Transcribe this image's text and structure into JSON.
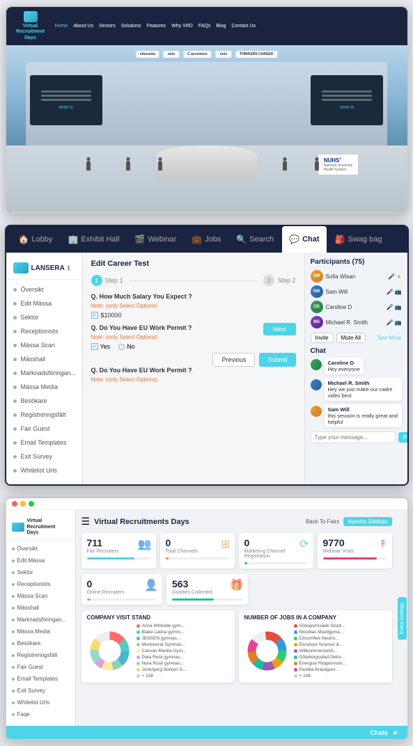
{
  "topWebsite": {
    "logoText": "Virtual\nRecruitment\nDays",
    "navLinks": [
      "Home",
      "About Us",
      "Sectors",
      "Solutions",
      "Features",
      "Why VRD",
      "FAQs",
      "Blog",
      "Contact Us"
    ],
    "sponsors": [
      "educenta",
      "nets",
      "accenture",
      "nets",
      "accenture",
      "CAREER"
    ],
    "nuhs": {
      "name": "NUHS",
      "subtitle": "National University\nHealth System"
    }
  },
  "middleApp": {
    "nav": {
      "items": [
        {
          "label": "Lobby",
          "icon": "🏠"
        },
        {
          "label": "Exhibit Hall",
          "icon": "🏢"
        },
        {
          "label": "Webinar",
          "icon": "🎬"
        },
        {
          "label": "Jobs",
          "icon": "💼"
        },
        {
          "label": "Search",
          "icon": "🔍"
        },
        {
          "label": "Chat",
          "icon": "💬"
        },
        {
          "label": "Swag bag",
          "icon": "🎒"
        }
      ],
      "activeTab": "Chat"
    },
    "sidebar": {
      "brand": "LANSERA",
      "items": [
        "Översikt",
        "Edit Mässa",
        "Sektor",
        "Receptionists",
        "Mässa Scan",
        "Mässhall",
        "Marknadsföringan...",
        "Mässa Media",
        "Besökare",
        "Registreringsfält",
        "Fair Guest",
        "Email Templates",
        "Exit Survey",
        "Whitelist Urls"
      ]
    },
    "mainContent": {
      "title": "Edit Career Test",
      "step1Label": "Step 1",
      "step2Label": "Step 2",
      "q1": "Q. How Much Salary You Expect ?",
      "q1Note": "Note: (only Select Options)",
      "q1Value": "$10000",
      "q2": "Q. Do You Have EU Work Permit ?",
      "q2Note": "Note: (only Select Options)",
      "q2Yes": "Yes",
      "q2No": "No",
      "q3": "Q. Do You Have EU Work Permit ?",
      "q3Note": "Note: (only Select Options)",
      "btnNext": "Next",
      "btnPrevious": "Previous",
      "btnSubmit": "Submit"
    },
    "rightPanel": {
      "participantsTitle": "Participants (75)",
      "participants": [
        {
          "name": "Sofia Wisan",
          "initials": "SW",
          "color": "orange"
        },
        {
          "name": "Sam Will",
          "initials": "SW",
          "color": "blue"
        },
        {
          "name": "Caroline D",
          "initials": "CD",
          "color": "green"
        },
        {
          "name": "Michael R. Smith",
          "initials": "MS",
          "color": "purple"
        }
      ],
      "btnInvite": "Invite",
      "btnMuteAll": "Mute All",
      "linkSeeMore": "See More",
      "chatTitle": "Chat",
      "messages": [
        {
          "sender": "Caroline D",
          "text": "Hey everyone",
          "avatarColor": "green"
        },
        {
          "sender": "Michael R. Smith",
          "text": "Hey we just make our cadre video best",
          "avatarColor": "blue"
        },
        {
          "sender": "Sam Will",
          "text": "this session is really great and helpful",
          "avatarColor": "orange"
        }
      ],
      "chatPlaceholder": "Type your message...",
      "btnReply": "Reply"
    }
  },
  "bottomDashboard": {
    "title": "Virtual Recruitments Days",
    "titlebarBtn": "Back To Fairs",
    "user": "Ayesha Siddiqui",
    "sidebar": {
      "brand": "Virtual\nRecruitment\nDays",
      "items": [
        "Översikt",
        "Edit Mässa",
        "Sektor",
        "Receptionists",
        "Mässa Scan",
        "Mässhall",
        "Marknadsföringan...",
        "Mässa Media",
        "Besökare",
        "Registreringsfält",
        "Fair Guest",
        "Email Templates",
        "Exit Survey",
        "Whitelist Urls",
        "Faqe"
      ]
    },
    "stats": [
      {
        "num": "711",
        "label": "Fair Recruiters",
        "barColor": "#4dd4e8",
        "barWidth": "75%",
        "iconColor": "cyan"
      },
      {
        "num": "0",
        "label": "Total Channels",
        "barColor": "#f0803a",
        "barWidth": "5%",
        "iconColor": "orange"
      },
      {
        "num": "0",
        "label": "Marketing Channel Registration",
        "barColor": "#20c09a",
        "barWidth": "5%",
        "iconColor": "teal"
      },
      {
        "num": "9770",
        "label": "Webinar Visits",
        "barColor": "#e04080",
        "barWidth": "85%",
        "iconColor": "pink"
      }
    ],
    "stats2": [
      {
        "num": "0",
        "label": "Online Recruiters",
        "barColor": "#4dd4e8",
        "barWidth": "5%"
      },
      {
        "num": "563",
        "label": "Goodies Collected",
        "barColor": "#20c09a",
        "barWidth": "60%"
      }
    ],
    "chart1": {
      "title": "COMPANY VISIT STAND",
      "legendItems": [
        {
          "label": "Anna Whitside gym...",
          "color": "#ff6b6b"
        },
        {
          "label": "Blake Latina gymm...",
          "color": "#4ecdc4"
        },
        {
          "label": "JENSEN gymnas...",
          "color": "#45b7d1"
        },
        {
          "label": "Montserrat Gymnas...",
          "color": "#96ceb4"
        },
        {
          "label": "Canvas Manila Gym...",
          "color": "#ffeaa7"
        },
        {
          "label": "Data Resk gymnas...",
          "color": "#dda0dd"
        },
        {
          "label": "Nora Rusti gymnas...",
          "color": "#98d8c8"
        },
        {
          "label": "Jönköping Borken G...",
          "color": "#f7dc6f"
        },
        {
          "label": "+ 108",
          "color": "#ccc"
        }
      ]
    },
    "chart2": {
      "title": "NUMBER OF JOBS IN A COMPANY",
      "legendItems": [
        {
          "label": "Götegormsade Stock...",
          "color": "#e74c3c"
        },
        {
          "label": "Nicoblas Muellgyma...",
          "color": "#3498db"
        },
        {
          "label": "Circumflex Neutro...",
          "color": "#2ecc71"
        },
        {
          "label": "Excelsior Science &...",
          "color": "#f39c12"
        },
        {
          "label": "Willkommensetzt...",
          "color": "#9b59b6"
        },
        {
          "label": "Göteborgsstad Detre...",
          "color": "#1abc9c"
        },
        {
          "label": "Energise Ridgesmum...",
          "color": "#e67e22"
        },
        {
          "label": "Pastilla Braistgum...",
          "color": "#e84393"
        },
        {
          "label": "+ 108",
          "color": "#ccc"
        }
      ]
    },
    "chatBarLabel": "Chats",
    "eventSettingsLabel": "Event Settings"
  }
}
